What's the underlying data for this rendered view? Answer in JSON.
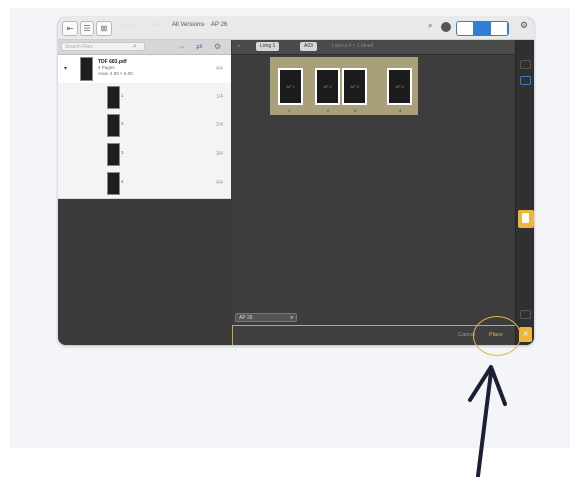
{
  "toolbar": {
    "app_icon": "window-toggle-icon",
    "list_icon": "list-icon",
    "doc_icon": "document-icon",
    "breadcrumb_root": "All Versions",
    "breadcrumb_current": "AP 26",
    "zoom_icon": "search-icon",
    "settings_icon": "gear-icon"
  },
  "left_panel": {
    "search_placeholder": "Search Files",
    "file": {
      "name": "TDF 683.pdf",
      "pages": "4 Pages",
      "size": "Area: 4.00 × 6.00",
      "page_count": "4/4"
    },
    "pages": [
      {
        "label": "1",
        "num": "1/4"
      },
      {
        "label": "2",
        "num": "2/4"
      },
      {
        "label": "3",
        "num": "3/4"
      },
      {
        "label": "4",
        "num": "4/4"
      }
    ]
  },
  "canvas": {
    "back_label": "◂",
    "layout_select": "Long 1",
    "sheet_select": "A03",
    "info_text": "Layout 4 × 1 bleed",
    "page_labels": [
      "AP 1",
      "AP 2",
      "AP 3",
      "AP 4"
    ],
    "page_marks": [
      "1",
      "2",
      "3",
      "4"
    ],
    "zoom_value": "AP 26",
    "cancel_label": "Cancel",
    "place_label": "Place"
  },
  "rail": {
    "tab_icon": "document-panel-icon",
    "close_icon": "close-icon",
    "close_glyph": "✕"
  },
  "colors": {
    "accent": "#f0b43c",
    "highlight_blue": "#2f7fd6",
    "sheet": "#a9a079",
    "annotation": "#1c1f36"
  }
}
